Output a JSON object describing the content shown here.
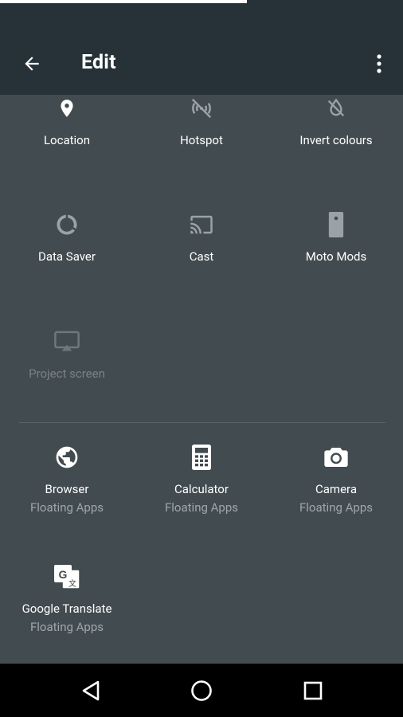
{
  "appbar": {
    "title": "Edit"
  },
  "tiles": {
    "location": {
      "label": "Location"
    },
    "hotspot": {
      "label": "Hotspot"
    },
    "invert": {
      "label": "Invert colours"
    },
    "datasaver": {
      "label": "Data Saver"
    },
    "cast": {
      "label": "Cast"
    },
    "motomods": {
      "label": "Moto Mods"
    },
    "project": {
      "label": "Project screen"
    }
  },
  "available": [
    {
      "label": "Browser",
      "sub": "Floating Apps"
    },
    {
      "label": "Calculator",
      "sub": "Floating Apps"
    },
    {
      "label": "Camera",
      "sub": "Floating Apps"
    },
    {
      "label": "Google Translate",
      "sub": "Floating Apps"
    }
  ]
}
